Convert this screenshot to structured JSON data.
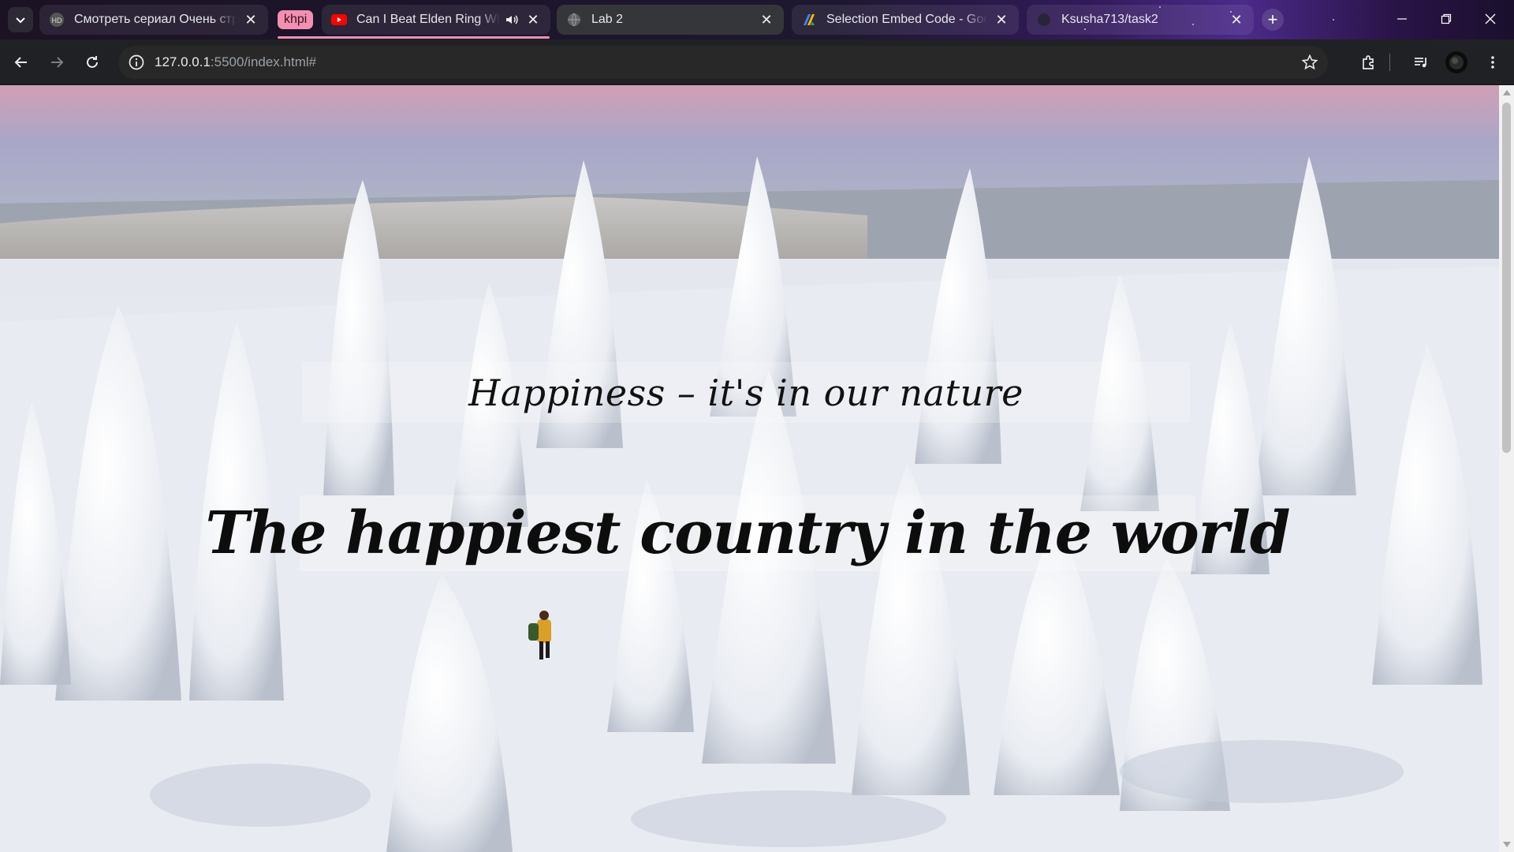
{
  "browser": {
    "tabs": [
      {
        "title": "Смотреть сериал Очень стран",
        "favicon": "site-icon",
        "state": "inactive"
      },
      {
        "title": "Can I Beat Elden Ring While",
        "favicon": "youtube-icon",
        "audio": true,
        "state": "inactive"
      },
      {
        "title": "Lab 2",
        "favicon": "globe-icon",
        "state": "active"
      },
      {
        "title": "Selection Embed Code - Googl",
        "favicon": "google-apps-script-icon",
        "state": "inactive"
      },
      {
        "title": "Ksusha713/task2",
        "favicon": "github-icon",
        "state": "inactive"
      }
    ],
    "tab_group_label": "khpi",
    "tab_group_color": "#f48fb1",
    "address": {
      "host": "127.0.0.1",
      "rest": ":5500/index.html#"
    }
  },
  "page": {
    "subtitle": "Happiness – it's in our nature",
    "headline": "The happiest country in the world"
  }
}
